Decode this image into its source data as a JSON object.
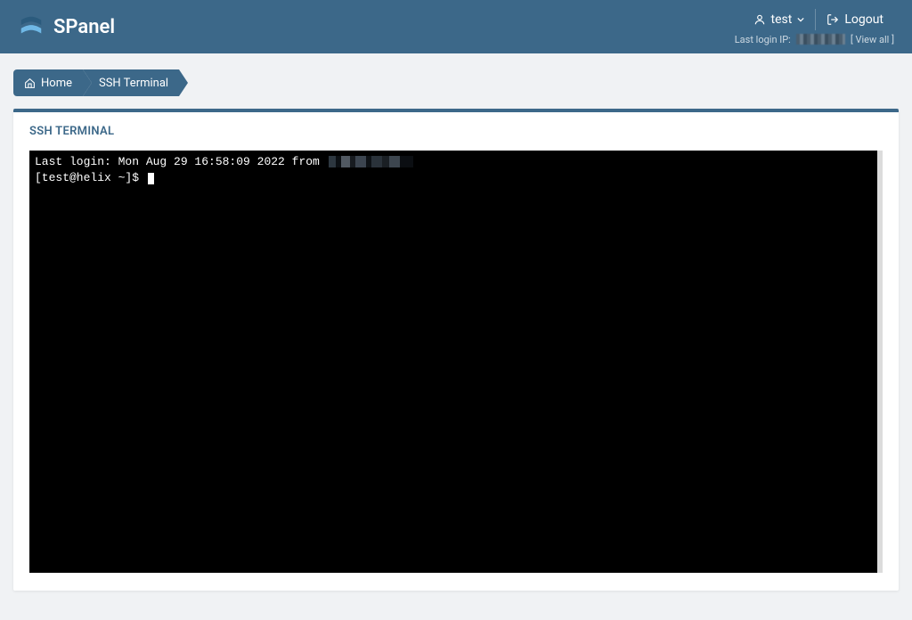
{
  "header": {
    "brand": "SPanel",
    "user_label": "test",
    "logout_label": "Logout",
    "last_login_prefix": "Last login IP:",
    "view_all_label": "[ View all ]"
  },
  "breadcrumb": {
    "home": "Home",
    "current": "SSH Terminal"
  },
  "panel": {
    "title": "SSH TERMINAL"
  },
  "terminal": {
    "line1_prefix": "Last login: Mon Aug 29 16:58:09 2022 from ",
    "prompt": "[test@helix ~]$ "
  }
}
